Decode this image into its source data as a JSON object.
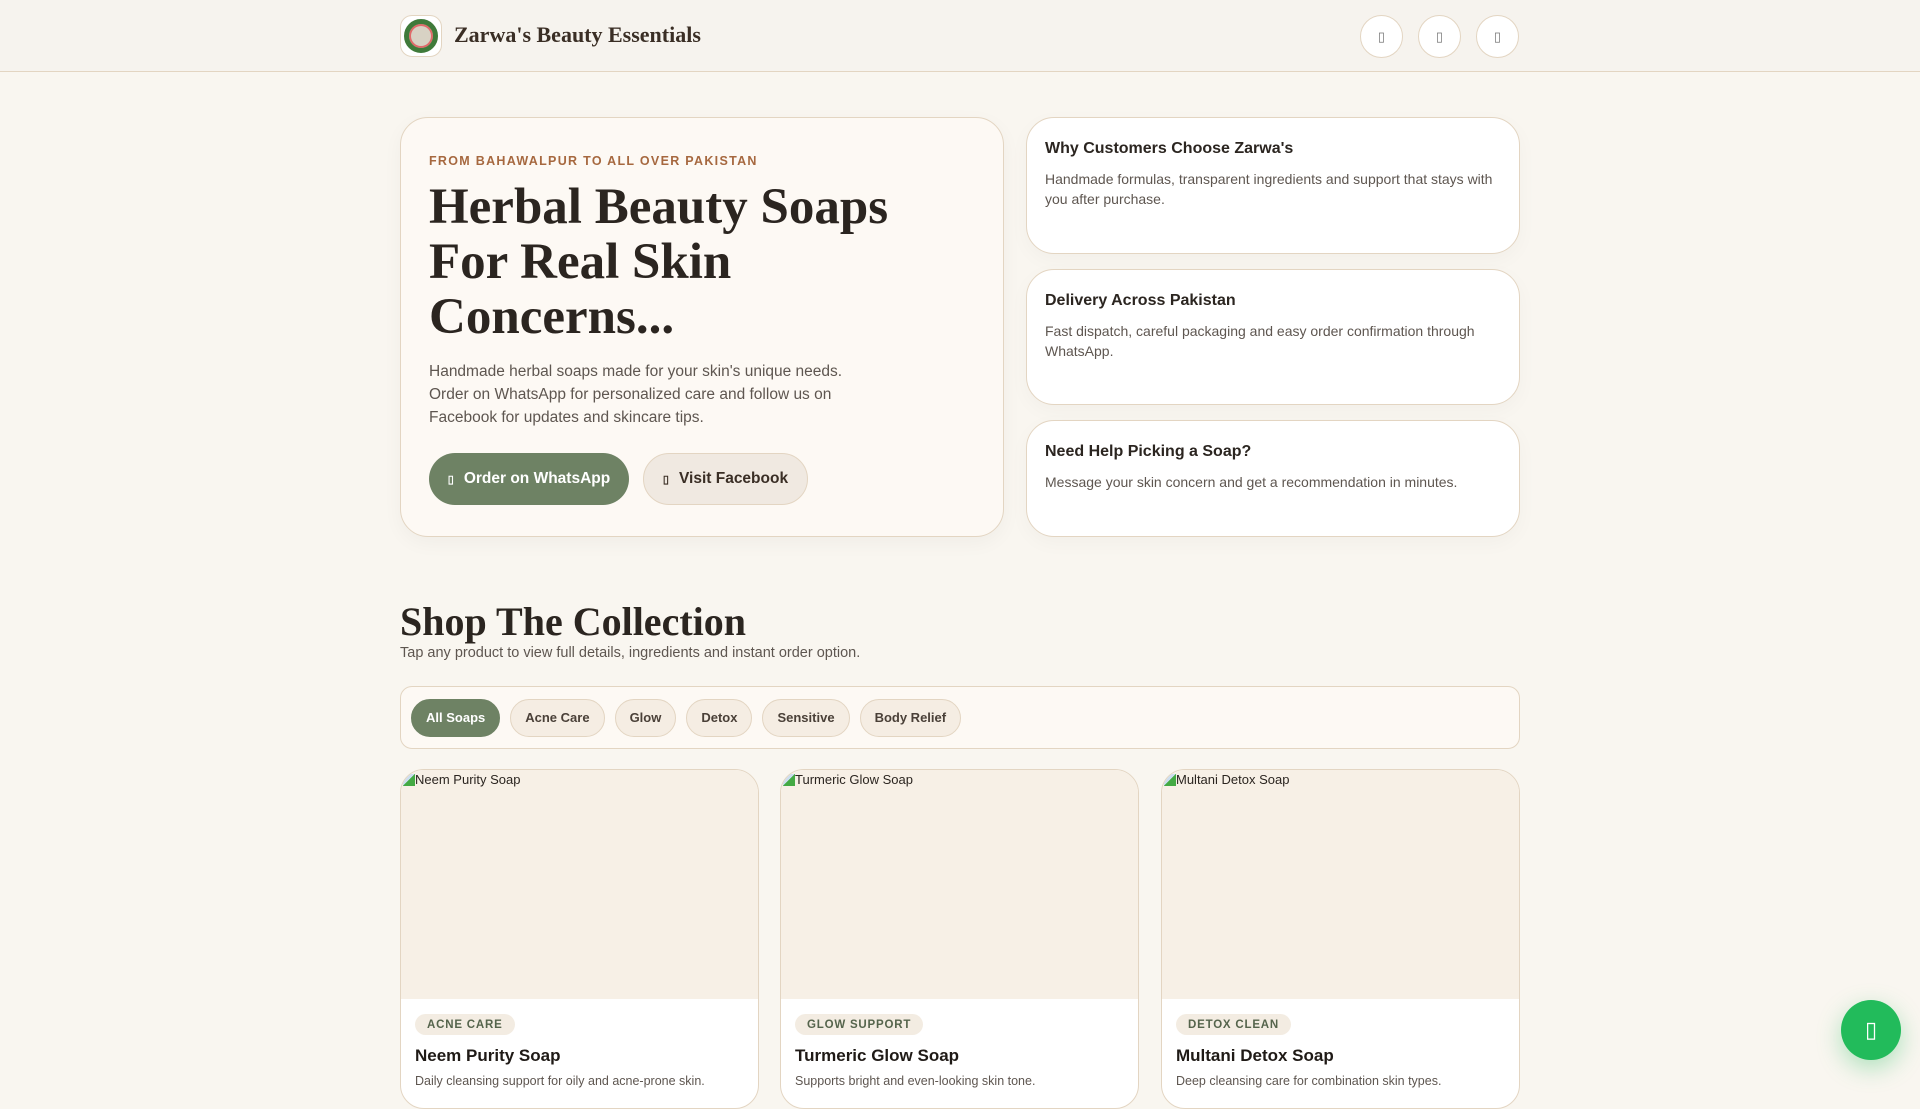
{
  "header": {
    "brand": "Zarwa's Beauty Essentials",
    "icons": [
      "whatsapp-icon",
      "facebook-icon",
      "cart-icon"
    ]
  },
  "hero": {
    "eyebrow": "FROM BAHAWALPUR TO ALL OVER PAKISTAN",
    "title": "Herbal Beauty Soaps For Real Skin Concerns...",
    "lead": "Handmade herbal soaps made for your skin's unique needs. Order on WhatsApp for personalized care and follow us on Facebook for updates and skincare tips.",
    "whatsapp_label": "Order on WhatsApp",
    "facebook_label": "Visit Facebook"
  },
  "info_cards": [
    {
      "title": "Why Customers Choose Zarwa's",
      "text": "Handmade formulas, transparent ingredients and support that stays with you after purchase."
    },
    {
      "title": "Delivery Across Pakistan",
      "text": "Fast dispatch, careful packaging and easy order confirmation through WhatsApp."
    },
    {
      "title": "Need Help Picking a Soap?",
      "text": "Message your skin concern and get a recommendation in minutes."
    }
  ],
  "shop": {
    "title": "Shop The Collection",
    "subtitle": "Tap any product to view full details, ingredients and instant order option.",
    "filters": [
      "All Soaps",
      "Acne Care",
      "Glow",
      "Detox",
      "Sensitive",
      "Body Relief"
    ],
    "active_filter": "All Soaps",
    "products": [
      {
        "alt": "Neem Purity Soap",
        "tag": "ACNE CARE",
        "name": "Neem Purity Soap",
        "desc": "Daily cleansing support for oily and acne-prone skin."
      },
      {
        "alt": "Turmeric Glow Soap",
        "tag": "GLOW SUPPORT",
        "name": "Turmeric Glow Soap",
        "desc": "Supports bright and even-looking skin tone."
      },
      {
        "alt": "Multani Detox Soap",
        "tag": "DETOX CLEAN",
        "name": "Multani Detox Soap",
        "desc": "Deep cleansing care for combination skin types."
      }
    ]
  },
  "colors": {
    "accent": "#6e8264",
    "whatsapp": "#22bb5b",
    "eyebrow": "#a6683f"
  }
}
